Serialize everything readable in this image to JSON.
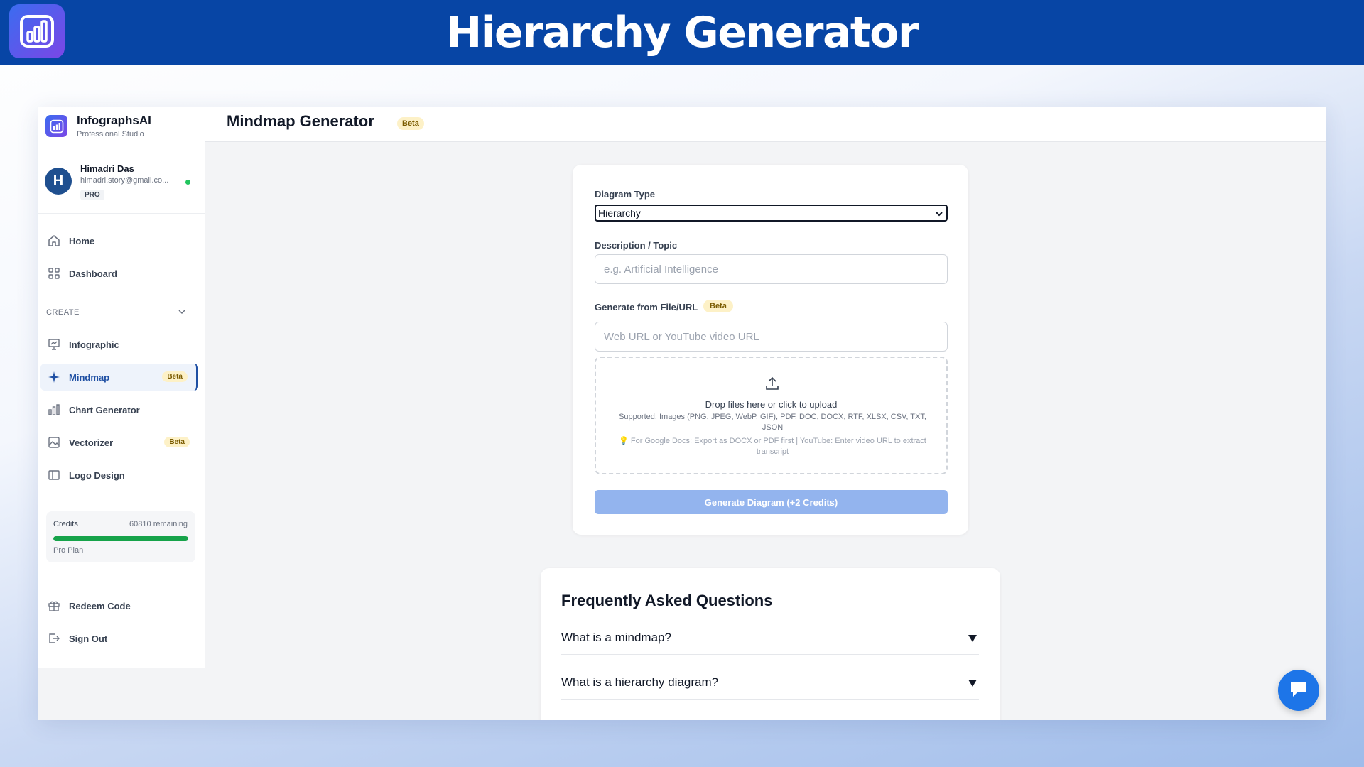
{
  "banner": {
    "title": "Hierarchy Generator",
    "logo_icon": "bar-chart-icon"
  },
  "brand": {
    "name": "InfographsAI",
    "subtitle": "Professional Studio"
  },
  "user": {
    "initial": "H",
    "name": "Himadri Das",
    "email": "himadri.story@gmail.co...",
    "plan_badge": "PRO",
    "status": "online"
  },
  "nav": {
    "home": "Home",
    "dashboard": "Dashboard",
    "section_create": "CREATE",
    "infographic": "Infographic",
    "mindmap": "Mindmap",
    "mindmap_badge": "Beta",
    "chart_generator": "Chart Generator",
    "vectorizer": "Vectorizer",
    "vectorizer_badge": "Beta",
    "logo_design": "Logo Design",
    "redeem_code": "Redeem Code",
    "sign_out": "Sign Out"
  },
  "credits": {
    "label": "Credits",
    "remaining": "60810 remaining",
    "plan": "Pro Plan",
    "fill_fraction": 1.0,
    "bar_color": "#16a34a"
  },
  "header": {
    "title": "Mindmap Generator",
    "badge": "Beta"
  },
  "form": {
    "diagram_type_label": "Diagram Type",
    "diagram_type_value": "Hierarchy",
    "description_label": "Description / Topic",
    "description_placeholder": "e.g. Artificial Intelligence",
    "file_url_label": "Generate from File/URL",
    "file_url_badge": "Beta",
    "url_placeholder": "Web URL or YouTube video URL",
    "drop_text": "Drop files here or click to upload",
    "supported_text": "Supported: Images (PNG, JPEG, WebP, GIF), PDF, DOC, DOCX, RTF, XLSX, CSV, TXT, JSON",
    "tip_text": "For Google Docs: Export as DOCX or PDF first | YouTube: Enter video URL to extract transcript",
    "generate_button": "Generate Diagram (+2 Credits)"
  },
  "faq": {
    "title": "Frequently Asked Questions",
    "items": [
      "What is a mindmap?",
      "What is a hierarchy diagram?"
    ]
  },
  "colors": {
    "banner": "#0745a5",
    "accent": "#1e4fa3",
    "button_disabled": "#93b4ee",
    "chat": "#1d75e8"
  }
}
